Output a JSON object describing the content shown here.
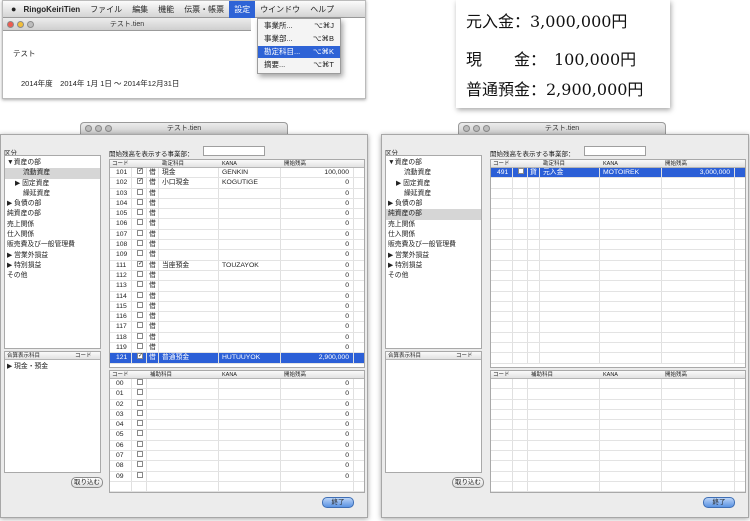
{
  "menubar": {
    "app": "RingoKeiriTien",
    "items": [
      "ファイル",
      "編集",
      "機能",
      "伝票・帳票",
      "設定",
      "ウインドウ",
      "ヘルプ"
    ],
    "selected": "設定"
  },
  "settings_menu": [
    {
      "label": "事業所...",
      "shortcut": "⌥⌘J"
    },
    {
      "label": "事業部...",
      "shortcut": "⌥⌘B"
    },
    {
      "label": "勘定科目...",
      "shortcut": "⌥⌘K"
    },
    {
      "label": "摘要...",
      "shortcut": "⌥⌘T"
    }
  ],
  "mini_doc": {
    "title": "テスト.tien",
    "company": "テスト",
    "period": "2014年度　2014年 1月 1日 〜 2014年12月31日"
  },
  "balance_box": {
    "line1": "元入金：3,000,000円",
    "line2": "現　　金：　100,000円",
    "line3": "普通預金：2,900,000円"
  },
  "left_window": {
    "title": "テスト.tien",
    "kubun_label": "区分",
    "tree": [
      {
        "label": "▼資産の部",
        "indent": 0,
        "selected": false
      },
      {
        "label": "流動資産",
        "indent": 2,
        "selected": true
      },
      {
        "label": "▶ 固定資産",
        "indent": 1,
        "selected": false
      },
      {
        "label": "繰延資産",
        "indent": 2,
        "selected": false
      },
      {
        "label": "▶ 負債の部",
        "indent": 0,
        "selected": false
      },
      {
        "label": "純資産の部",
        "indent": 0,
        "selected": false
      },
      {
        "label": "売上関係",
        "indent": 0,
        "selected": false
      },
      {
        "label": "仕入関係",
        "indent": 0,
        "selected": false
      },
      {
        "label": "販売費及び一般管理費",
        "indent": 0,
        "selected": false
      },
      {
        "label": "▶ 営業外損益",
        "indent": 0,
        "selected": false
      },
      {
        "label": "▶ 特別損益",
        "indent": 0,
        "selected": false
      },
      {
        "label": "その他",
        "indent": 0,
        "selected": false
      }
    ],
    "combined_header": [
      "合算表示科目",
      "コード"
    ],
    "combined_items": [
      "▶ 現金・預金"
    ],
    "import_button": "取り込む",
    "dept_label": "開始残高を表示する事業部：",
    "main_headers": [
      "コード",
      "",
      "",
      "勘定科目",
      "KANA",
      "開始残高"
    ],
    "main_rows": [
      {
        "code": "101",
        "check": "✓",
        "dc": "借",
        "name": "現金",
        "kana": "GENKIN",
        "amount": "100,000",
        "hl": false
      },
      {
        "code": "102",
        "check": "✓",
        "dc": "借",
        "name": "小口現金",
        "kana": "KOGUTIGE",
        "amount": "0",
        "hl": false
      },
      {
        "code": "103",
        "check": "",
        "dc": "借",
        "name": "",
        "kana": "",
        "amount": "0",
        "hl": false
      },
      {
        "code": "104",
        "check": "",
        "dc": "借",
        "name": "",
        "kana": "",
        "amount": "0",
        "hl": false
      },
      {
        "code": "105",
        "check": "",
        "dc": "借",
        "name": "",
        "kana": "",
        "amount": "0",
        "hl": false
      },
      {
        "code": "106",
        "check": "",
        "dc": "借",
        "name": "",
        "kana": "",
        "amount": "0",
        "hl": false
      },
      {
        "code": "107",
        "check": "",
        "dc": "借",
        "name": "",
        "kana": "",
        "amount": "0",
        "hl": false
      },
      {
        "code": "108",
        "check": "",
        "dc": "借",
        "name": "",
        "kana": "",
        "amount": "0",
        "hl": false
      },
      {
        "code": "109",
        "check": "",
        "dc": "借",
        "name": "",
        "kana": "",
        "amount": "0",
        "hl": false
      },
      {
        "code": "111",
        "check": "✓",
        "dc": "借",
        "name": "当座預金",
        "kana": "TOUZAYOK",
        "amount": "0",
        "hl": false
      },
      {
        "code": "112",
        "check": "",
        "dc": "借",
        "name": "",
        "kana": "",
        "amount": "0",
        "hl": false
      },
      {
        "code": "113",
        "check": "",
        "dc": "借",
        "name": "",
        "kana": "",
        "amount": "0",
        "hl": false
      },
      {
        "code": "114",
        "check": "",
        "dc": "借",
        "name": "",
        "kana": "",
        "amount": "0",
        "hl": false
      },
      {
        "code": "115",
        "check": "",
        "dc": "借",
        "name": "",
        "kana": "",
        "amount": "0",
        "hl": false
      },
      {
        "code": "116",
        "check": "",
        "dc": "借",
        "name": "",
        "kana": "",
        "amount": "0",
        "hl": false
      },
      {
        "code": "117",
        "check": "",
        "dc": "借",
        "name": "",
        "kana": "",
        "amount": "0",
        "hl": false
      },
      {
        "code": "118",
        "check": "",
        "dc": "借",
        "name": "",
        "kana": "",
        "amount": "0",
        "hl": false
      },
      {
        "code": "119",
        "check": "",
        "dc": "借",
        "name": "",
        "kana": "",
        "amount": "0",
        "hl": false
      },
      {
        "code": "121",
        "check": "✓",
        "dc": "借",
        "name": "普通預金",
        "kana": "HUTUUYOK",
        "amount": "2,900,000",
        "hl": true
      }
    ],
    "sub_headers": [
      "コード",
      "",
      "補助科目",
      "KANA",
      "開始残高"
    ],
    "sub_rows": [
      {
        "code": "00",
        "amount": "0"
      },
      {
        "code": "01",
        "amount": "0"
      },
      {
        "code": "02",
        "amount": "0"
      },
      {
        "code": "03",
        "amount": "0"
      },
      {
        "code": "04",
        "amount": "0"
      },
      {
        "code": "05",
        "amount": "0"
      },
      {
        "code": "06",
        "amount": "0"
      },
      {
        "code": "07",
        "amount": "0"
      },
      {
        "code": "08",
        "amount": "0"
      },
      {
        "code": "09",
        "amount": "0"
      }
    ],
    "finish_button": "終了"
  },
  "right_window": {
    "title": "テスト.tien",
    "kubun_label": "区分",
    "tree": [
      {
        "label": "▼資産の部",
        "indent": 0,
        "selected": false
      },
      {
        "label": "流動資産",
        "indent": 2,
        "selected": false
      },
      {
        "label": "▶ 固定資産",
        "indent": 1,
        "selected": false
      },
      {
        "label": "繰延資産",
        "indent": 2,
        "selected": false
      },
      {
        "label": "▶ 負債の部",
        "indent": 0,
        "selected": false
      },
      {
        "label": "純資産の部",
        "indent": 0,
        "selected": true
      },
      {
        "label": "売上関係",
        "indent": 0,
        "selected": false
      },
      {
        "label": "仕入関係",
        "indent": 0,
        "selected": false
      },
      {
        "label": "販売費及び一般管理費",
        "indent": 0,
        "selected": false
      },
      {
        "label": "▶ 営業外損益",
        "indent": 0,
        "selected": false
      },
      {
        "label": "▶ 特別損益",
        "indent": 0,
        "selected": false
      },
      {
        "label": "その他",
        "indent": 0,
        "selected": false
      }
    ],
    "combined_header": [
      "合算表示科目",
      "コード"
    ],
    "import_button": "取り込む",
    "dept_label": "開始残高を表示する事業部：",
    "main_headers": [
      "コード",
      "",
      "",
      "勘定科目",
      "KANA",
      "開始残高"
    ],
    "main_rows": [
      {
        "code": "491",
        "check": "",
        "dc": "貸",
        "name": "元入金",
        "kana": "MOTOIREK",
        "amount": "3,000,000",
        "hl": true
      }
    ],
    "sub_headers": [
      "コード",
      "",
      "補助科目",
      "KANA",
      "開始残高"
    ],
    "finish_button": "終了"
  }
}
